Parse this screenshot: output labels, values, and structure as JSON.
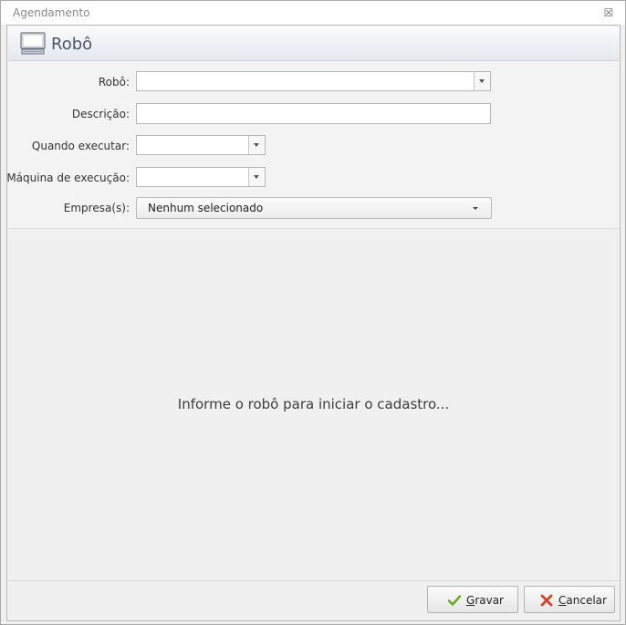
{
  "window": {
    "title": "Agendamento"
  },
  "header": {
    "title": "Robô"
  },
  "form": {
    "robo_label": "Robô:",
    "descricao_label": "Descrição:",
    "quando_label": "Quando executar:",
    "maquina_label": "Máquina de execução:",
    "empresas_label": "Empresa(s):",
    "empresas_value": "Nenhum selecionado"
  },
  "content": {
    "message": "Informe o robô para iniciar o cadastro..."
  },
  "buttons": {
    "gravar_first": "G",
    "gravar_rest": "ravar",
    "cancelar_first": "C",
    "cancelar_rest": "ancelar"
  },
  "colors": {
    "check_green": "#6aa82a",
    "cancel_red": "#d0452a"
  },
  "icons": [
    "close-icon",
    "monitor-icon",
    "chevron-down-icon",
    "check-icon",
    "cancel-x-icon"
  ]
}
